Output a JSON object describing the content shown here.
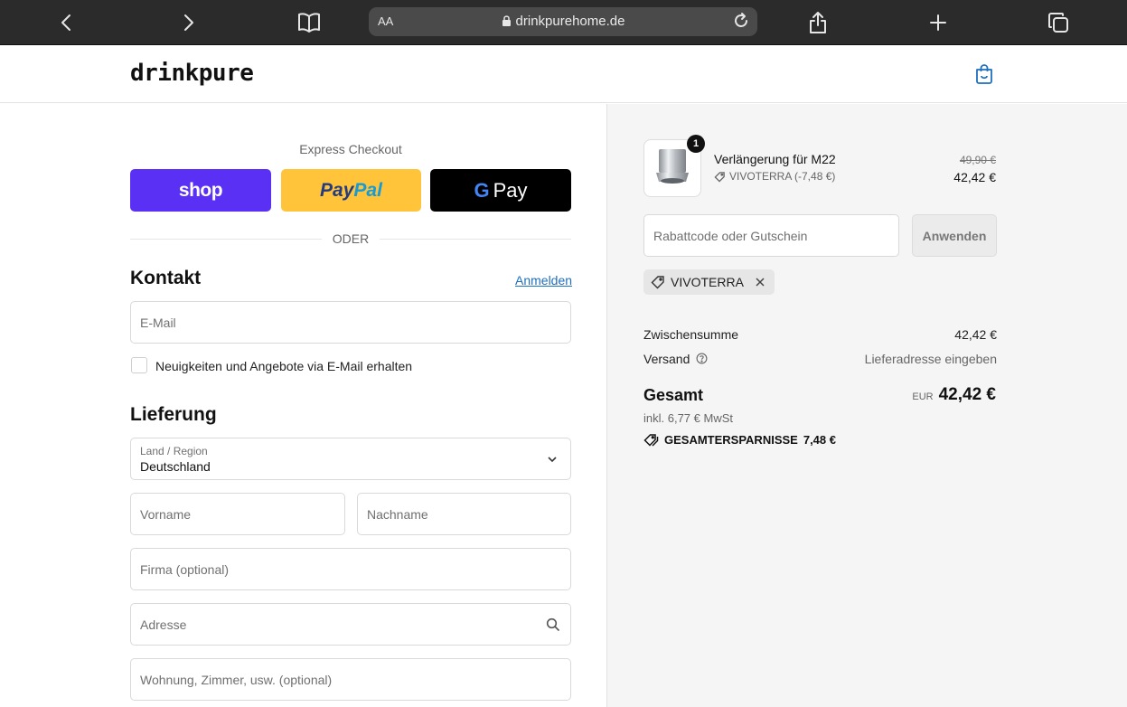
{
  "browser": {
    "aa_label": "AA",
    "url": "drinkpurehome.de"
  },
  "header": {
    "logo": "drinkpure"
  },
  "express": {
    "label": "Express Checkout",
    "shop_label": "shop",
    "paypal_part1": "Pay",
    "paypal_part2": "Pal",
    "gpay_label": "Pay",
    "gpay_g": "G",
    "or_label": "ODER"
  },
  "contact": {
    "title": "Kontakt",
    "login_link": "Anmelden",
    "email_placeholder": "E-Mail",
    "newsletter_label": "Neuigkeiten und Angebote via E-Mail erhalten"
  },
  "delivery": {
    "title": "Lieferung",
    "country_label": "Land / Region",
    "country_value": "Deutschland",
    "first_name_placeholder": "Vorname",
    "last_name_placeholder": "Nachname",
    "company_placeholder": "Firma (optional)",
    "address_placeholder": "Adresse",
    "apartment_placeholder": "Wohnung, Zimmer, usw. (optional)"
  },
  "summary": {
    "item": {
      "quantity": "1",
      "name": "Verlängerung für M22",
      "discount": "VIVOTERRA (-7,48 €)",
      "old_price": "49,90 €",
      "price": "42,42 €"
    },
    "coupon_placeholder": "Rabattcode oder Gutschein",
    "apply_label": "Anwenden",
    "applied_code": "VIVOTERRA",
    "subtotal_label": "Zwischensumme",
    "subtotal_value": "42,42 €",
    "shipping_label": "Versand",
    "shipping_value": "Lieferadresse eingeben",
    "total_label": "Gesamt",
    "currency": "EUR",
    "total_value": "42,42 €",
    "tax_note": "inkl. 6,77 € MwSt",
    "savings_label": "GESAMTERSPARNISSE",
    "savings_value": "7,48 €"
  },
  "colors": {
    "shop_pay": "#5a31f4",
    "paypal": "#ffc439",
    "gpay": "#000000",
    "link": "#1f6fbf"
  }
}
